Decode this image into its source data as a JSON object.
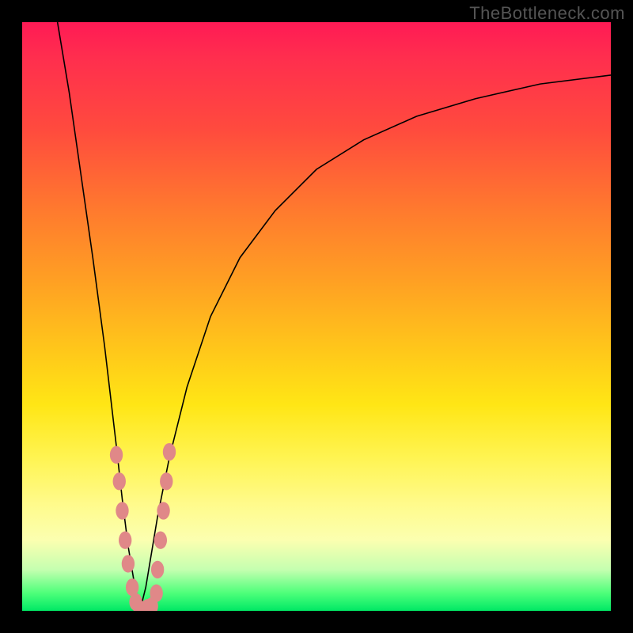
{
  "watermark": "TheBottleneck.com",
  "colors": {
    "frame": "#000000",
    "curve": "#000000",
    "dot": "#e08888"
  },
  "chart_data": {
    "type": "line",
    "title": "",
    "xlabel": "",
    "ylabel": "",
    "xlim": [
      0,
      100
    ],
    "ylim": [
      0,
      100
    ],
    "grid": false,
    "legend": false,
    "description": "V-shaped bottleneck curve with minimum near x≈20; vertical gradient background encodes severity (red high, green low).",
    "series": [
      {
        "name": "left_branch",
        "x": [
          6,
          8,
          10,
          12,
          14,
          16,
          17,
          18,
          19,
          20
        ],
        "y": [
          100,
          88,
          74,
          60,
          45,
          28,
          19,
          11,
          5,
          0
        ]
      },
      {
        "name": "right_branch",
        "x": [
          20,
          21,
          22,
          23,
          25,
          28,
          32,
          37,
          43,
          50,
          58,
          67,
          77,
          88,
          100
        ],
        "y": [
          0,
          4,
          10,
          16,
          26,
          38,
          50,
          60,
          68,
          75,
          80,
          84,
          87,
          89.5,
          91
        ]
      }
    ],
    "points": [
      {
        "x": 16.0,
        "y": 26.5
      },
      {
        "x": 16.5,
        "y": 22.0
      },
      {
        "x": 17.0,
        "y": 17.0
      },
      {
        "x": 17.5,
        "y": 12.0
      },
      {
        "x": 18.0,
        "y": 8.0
      },
      {
        "x": 18.7,
        "y": 4.0
      },
      {
        "x": 19.3,
        "y": 1.5
      },
      {
        "x": 20.0,
        "y": 0.0
      },
      {
        "x": 20.7,
        "y": 0.2
      },
      {
        "x": 21.3,
        "y": 0.5
      },
      {
        "x": 22.0,
        "y": 0.8
      },
      {
        "x": 22.8,
        "y": 3.0
      },
      {
        "x": 23.0,
        "y": 7.0
      },
      {
        "x": 23.5,
        "y": 12.0
      },
      {
        "x": 24.0,
        "y": 17.0
      },
      {
        "x": 24.5,
        "y": 22.0
      },
      {
        "x": 25.0,
        "y": 27.0
      }
    ]
  }
}
